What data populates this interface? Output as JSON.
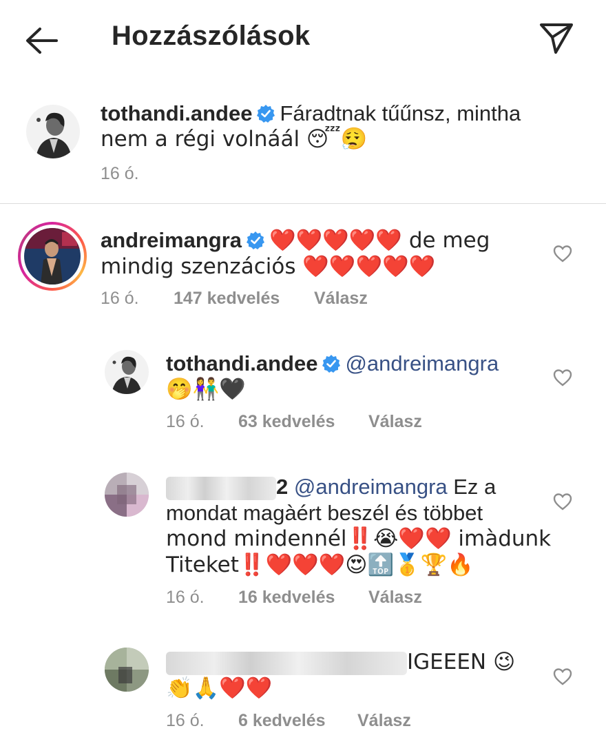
{
  "header": {
    "title": "Hozzászólások",
    "back_icon": "arrow-left-icon",
    "send_icon": "paper-plane-icon"
  },
  "caption": {
    "username": "tothandi.andee",
    "text_line1": "Fáradtnak tűűnsz, mintha",
    "text_line2": "nem a régi volnáál 😴😮‍💨",
    "time": "16 ó."
  },
  "comments": [
    {
      "username": "andreimangra",
      "text_line1": "❤️❤️❤️❤️❤️ de meg",
      "text_line2": "mindig szenzációs ❤️❤️❤️❤️❤️",
      "time": "16 ó.",
      "likes": "147 kedvelés",
      "reply": "Válasz"
    },
    {
      "username": "tothandi.andee",
      "mention": "@andreimangra",
      "text_line2": "🤭👫🖤",
      "time": "16 ó.",
      "likes": "63 kedvelés",
      "reply": "Válasz"
    },
    {
      "username_visible": "2",
      "mention": "@andreimangra",
      "text_line1_rest": " Ez a",
      "text_line2": "mondat magàért beszél és többet",
      "text_line3": "mond mindennél‼️😭❤️❤️ imàdunk",
      "text_line4": "Titeket‼️❤️❤️❤️😍🔝🥇🏆🔥",
      "time": "16 ó.",
      "likes": "16 kedvelés",
      "reply": "Válasz"
    },
    {
      "text_line1_visible": "IGEEEN 😉",
      "text_line2": "👏🙏❤️❤️",
      "time": "16 ó.",
      "likes": "6 kedvelés",
      "reply": "Válasz"
    }
  ],
  "colors": {
    "verified": "#3897f0",
    "mention": "#385185",
    "meta": "#8e8e8e",
    "heart_red": "#e0102a"
  }
}
